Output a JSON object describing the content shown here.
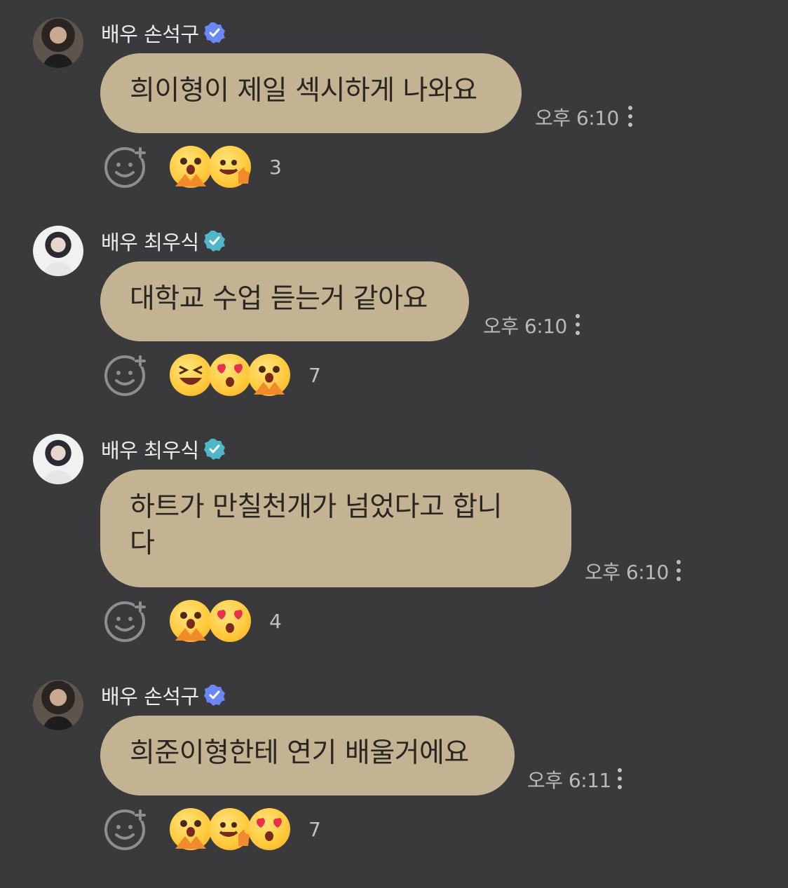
{
  "messages": [
    {
      "author": "배우 손석구",
      "avatar": "son",
      "badge_color": "#6b86f5",
      "text": "희이형이 제일 섹시하게 나와요",
      "time": "오후 6:10",
      "reactions": [
        "crying-hands-emoji",
        "thumbs-up-face-emoji"
      ],
      "reaction_count": "3"
    },
    {
      "author": "배우 최우식",
      "avatar": "choi",
      "badge_color": "#4fb7c9",
      "text": "대학교 수업 듣는거 같아요",
      "time": "오후 6:10",
      "reactions": [
        "laughing-squint-emoji",
        "heart-eyes-emoji",
        "crying-hands-emoji"
      ],
      "reaction_count": "7"
    },
    {
      "author": "배우 최우식",
      "avatar": "choi",
      "badge_color": "#4fb7c9",
      "text": "하트가 만칠천개가 넘었다고 합니\n다",
      "time": "오후 6:10",
      "reactions": [
        "crying-hands-emoji",
        "heart-eyes-emoji"
      ],
      "reaction_count": "4"
    },
    {
      "author": "배우 손석구",
      "avatar": "son",
      "badge_color": "#6b86f5",
      "text": "희준이형한테 연기 배울거에요",
      "time": "오후 6:11",
      "reactions": [
        "crying-hands-emoji",
        "thumbs-up-face-emoji",
        "heart-eyes-emoji"
      ],
      "reaction_count": "7"
    }
  ]
}
